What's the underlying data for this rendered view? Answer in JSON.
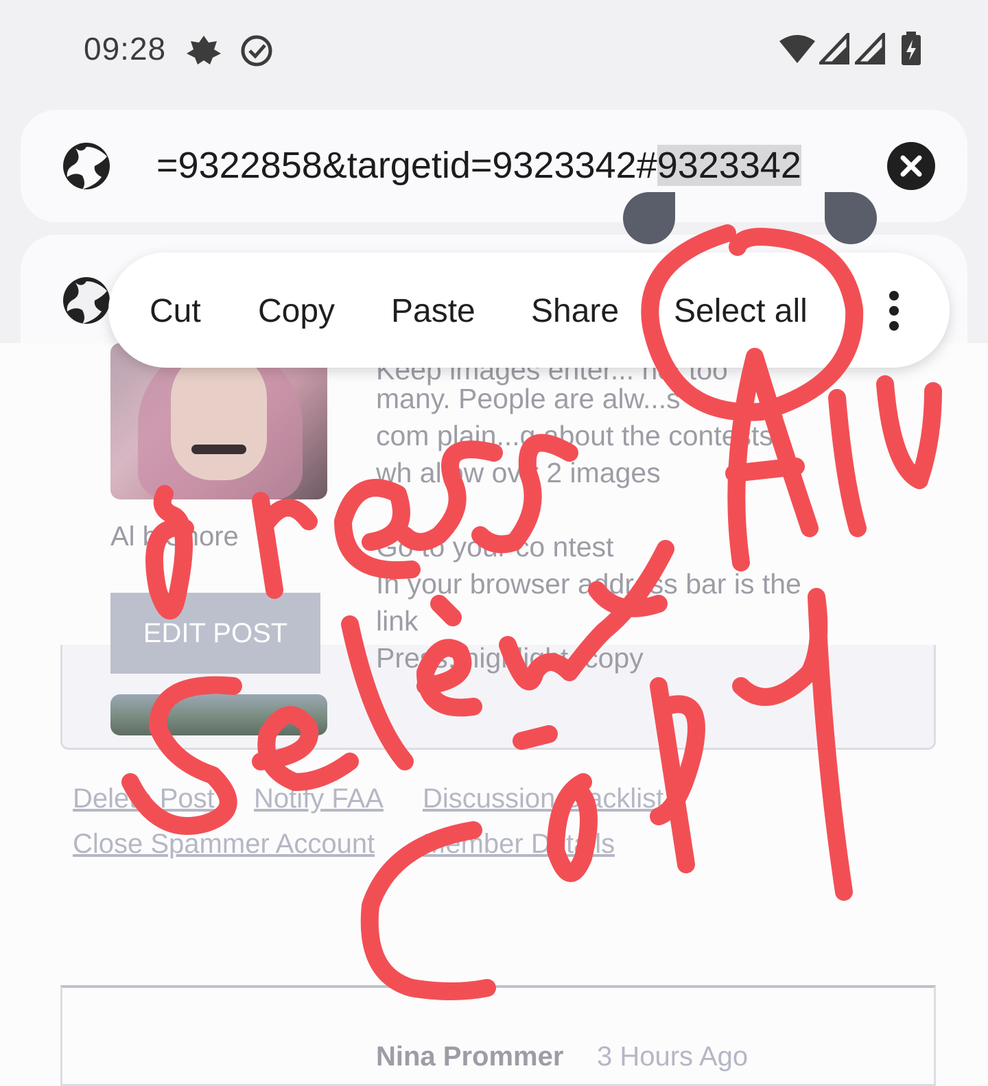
{
  "status_bar": {
    "time": "09:28",
    "icons": [
      "leaf-notification-icon",
      "check-circle-icon",
      "wifi-icon",
      "cell-signal-icon",
      "cell-signal-icon",
      "battery-charging-icon"
    ]
  },
  "address_bar": {
    "url_visible_prefix": "=9322858&targetid=9323342#",
    "url_selected": "9323342",
    "site_icon": "globe-icon",
    "clear_icon": "close-icon"
  },
  "context_menu": {
    "items": [
      "Cut",
      "Copy",
      "Paste",
      "Share",
      "Select all"
    ],
    "more_icon": "more-vertical-icon"
  },
  "post_1": {
    "author": "Al b Shore",
    "edit_label": "EDIT POST",
    "lines": [
      "Keep images enter... not too",
      "many. People are alw...s",
      "com plain...g about the contests",
      "wh allow ov r 2 images",
      "",
      "Go to your co ntest",
      "In your browser address bar is the",
      "link",
      "Press, highlight, copy"
    ]
  },
  "admin_links": {
    "row1": [
      "Delete Post",
      "Notify FAA",
      "Discussion Blacklist"
    ],
    "row2": [
      "Close Spammer Account",
      "Member Details"
    ]
  },
  "post_2": {
    "author": "Nina Prommer",
    "time": "3 Hours Ago"
  },
  "annotation": {
    "color": "#f24f55",
    "words": [
      "Press All",
      "Select",
      "-",
      "Copy"
    ]
  }
}
